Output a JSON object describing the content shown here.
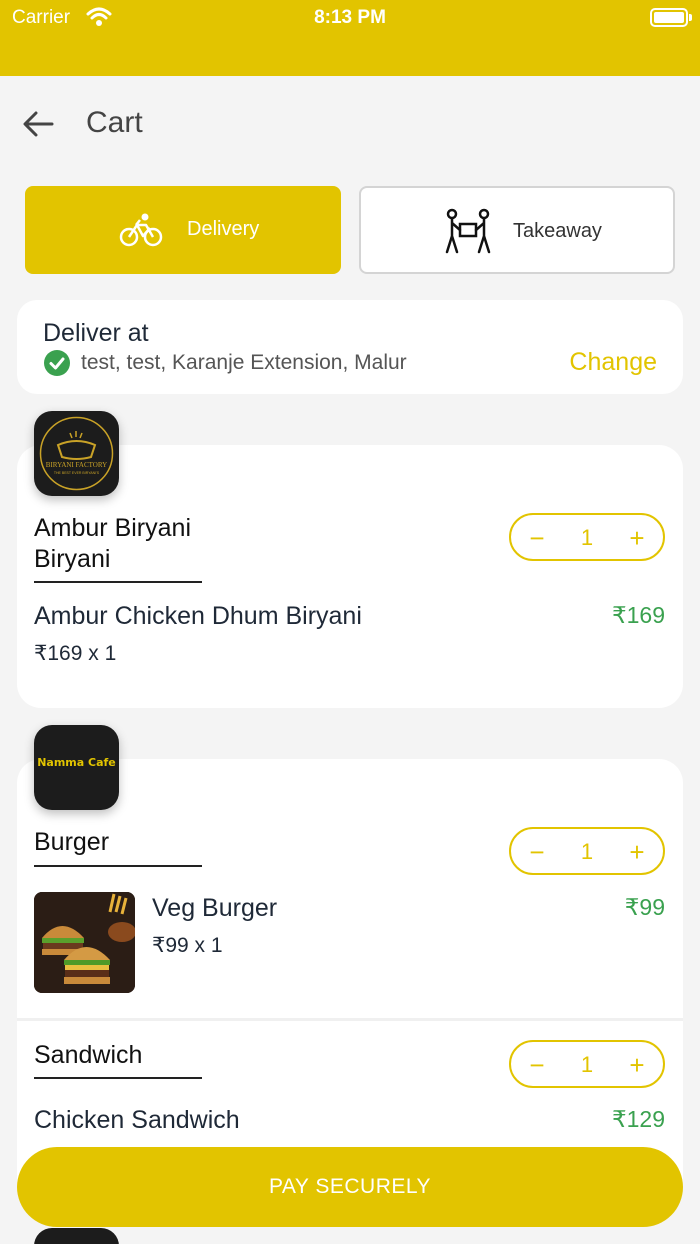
{
  "status_bar": {
    "carrier": "Carrier",
    "time": "8:13 PM"
  },
  "header": {
    "title": "Cart",
    "back_icon": "arrow-left-icon"
  },
  "modes": {
    "delivery": {
      "label": "Delivery",
      "icon": "bicycle-icon",
      "selected": true
    },
    "takeaway": {
      "label": "Takeaway",
      "icon": "two-people-carrying-box-icon",
      "selected": false
    }
  },
  "address": {
    "title": "Deliver at",
    "text": "test, test, Karanje Extension, Malur",
    "change_label": "Change"
  },
  "restaurants": [
    {
      "logo_text": "BIRYANI FACTORY",
      "logo_subtext": "THE BEST EVER BIRYANI'S",
      "categories": [
        {
          "name_line1": "Ambur Biryani",
          "name_line2": "Biryani",
          "quantity": "1",
          "minus": "−",
          "plus": "+",
          "item": {
            "name": "Ambur Chicken Dhum Biryani",
            "unit": "₹169 x 1",
            "price": "₹169"
          }
        }
      ]
    },
    {
      "logo_text": "Namma Cafe",
      "categories": [
        {
          "name": "Burger",
          "quantity": "1",
          "minus": "−",
          "plus": "+",
          "item": {
            "name": "Veg Burger",
            "unit": "₹99 x 1",
            "price": "₹99"
          }
        },
        {
          "name": "Sandwich",
          "quantity": "1",
          "minus": "−",
          "plus": "+",
          "item": {
            "name": "Chicken Sandwich",
            "price": "₹129"
          }
        }
      ]
    }
  ],
  "pay_button": {
    "label": "PAY SECURELY"
  },
  "colors": {
    "accent": "#e2c400",
    "price_green": "#3aa14f"
  }
}
